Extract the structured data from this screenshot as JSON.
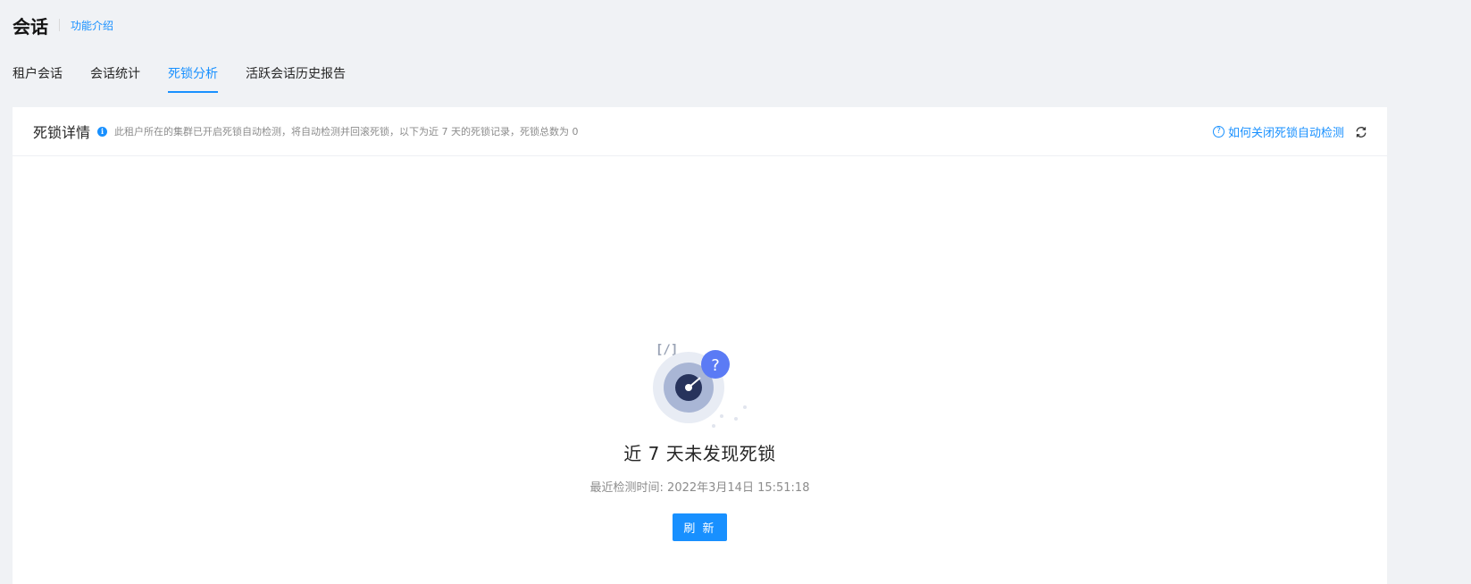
{
  "header": {
    "title": "会话",
    "feature_link": "功能介绍"
  },
  "tabs": [
    {
      "label": "租户会话",
      "active": false
    },
    {
      "label": "会话统计",
      "active": false
    },
    {
      "label": "死锁分析",
      "active": true
    },
    {
      "label": "活跃会话历史报告",
      "active": false
    }
  ],
  "card": {
    "title": "死锁详情",
    "info_icon": "info-icon",
    "description": "此租户所在的集群已开启死锁自动检测，将自动检测并回滚死锁，以下为近 7 天的死锁记录，死锁总数为 0",
    "help_link": "如何关闭死锁自动检测",
    "help_icon": "question-circle-icon",
    "refresh_icon": "refresh-icon"
  },
  "empty_state": {
    "illustration_symbol": "?",
    "illustration_code": "[/]",
    "title": "近 7 天未发现死锁",
    "last_check": "最近检测时间: 2022年3月14日 15:51:18",
    "refresh_button": "刷 新"
  },
  "colors": {
    "primary": "#1890ff",
    "page_bg": "#f0f2f5",
    "card_bg": "#ffffff"
  }
}
